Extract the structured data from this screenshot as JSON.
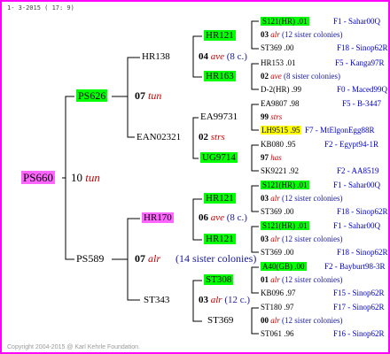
{
  "header": "1- 3-2015 ( 17: 9)",
  "footer": "Copyright 2004-2015 @ Karl Kehrle Foundation.",
  "root": {
    "name": "PS660",
    "year": "10",
    "tag": "tun"
  },
  "gen2": [
    {
      "name": "PS626",
      "year": "07",
      "tag": "tun"
    },
    {
      "name": "PS589",
      "year": "07",
      "tag": "alr",
      "extra": "(14 sister colonies)"
    }
  ],
  "gen3": [
    {
      "name": "HR138",
      "year": "04",
      "tag": "ave",
      "extra": "(8 c.)"
    },
    {
      "name": "EAN02321",
      "year": "02",
      "tag": "strs"
    },
    {
      "name": "HR170",
      "year": "06",
      "tag": "ave",
      "extra": "(8 c.)"
    },
    {
      "name": "ST343",
      "year": "03",
      "tag": "alr",
      "extra": "(12 c.)"
    }
  ],
  "gen4": [
    "HR121",
    "HR163",
    "EA99731",
    "UG9714",
    "HR121",
    "HR121",
    "ST308",
    "ST369"
  ],
  "gen4_years": [
    {
      "year": "99",
      "tag": "strs"
    },
    {
      "year": "97",
      "tag": "has"
    },
    {
      "year": "00",
      "tag": "alr"
    }
  ],
  "gen5": [
    {
      "a": "S121(HR) .01",
      "b": "F1 - Sahar00Q"
    },
    {
      "a": "03",
      "t": "alr",
      "c": "(12 sister colonies)"
    },
    {
      "a": "ST369 .00",
      "b": "F18 - Sinop62R"
    },
    {
      "a": "HR153 .01",
      "b": "F5 - Kanga97R"
    },
    {
      "a": "02",
      "t": "ave",
      "c": "(8 sister colonies)"
    },
    {
      "a": "D-2(HR) .99",
      "b": "F0 - Maced99Q"
    },
    {
      "a": "EA9807 .98",
      "b": "F5 - B-3447"
    },
    {
      "a": "LH9515 .95",
      "b": "F7 - MtElgonEgg88R"
    },
    {
      "a": "KB080 .95",
      "b": "F2 - Egypt94-1R"
    },
    {
      "a": "SK9221 .92",
      "b": "F2 - AA8519"
    },
    {
      "a": "S121(HR) .01",
      "b": "F1 - Sahar00Q"
    },
    {
      "a": "03",
      "t": "alr",
      "c": "(12 sister colonies)"
    },
    {
      "a": "ST369 .00",
      "b": "F18 - Sinop62R"
    },
    {
      "a": "S121(HR) .01",
      "b": "F1 - Sahar00Q"
    },
    {
      "a": "03",
      "t": "alr",
      "c": "(12 sister colonies)"
    },
    {
      "a": "ST369 .00",
      "b": "F18 - Sinop62R"
    },
    {
      "a": "A40(GB) .00",
      "b": "F2 - Bayburt98-3R"
    },
    {
      "a": "01",
      "t": "alr",
      "c": "(12 sister colonies)"
    },
    {
      "a": "KB096 .97",
      "b": "F15 - Sinop62R"
    },
    {
      "a": "ST180 .97",
      "b": "F17 - Sinop62R"
    },
    {
      "a": "00",
      "t": "alr",
      "c": "(12 sister colonies)"
    },
    {
      "a": "ST061 .96",
      "b": "F16 - Sinop62R"
    }
  ]
}
